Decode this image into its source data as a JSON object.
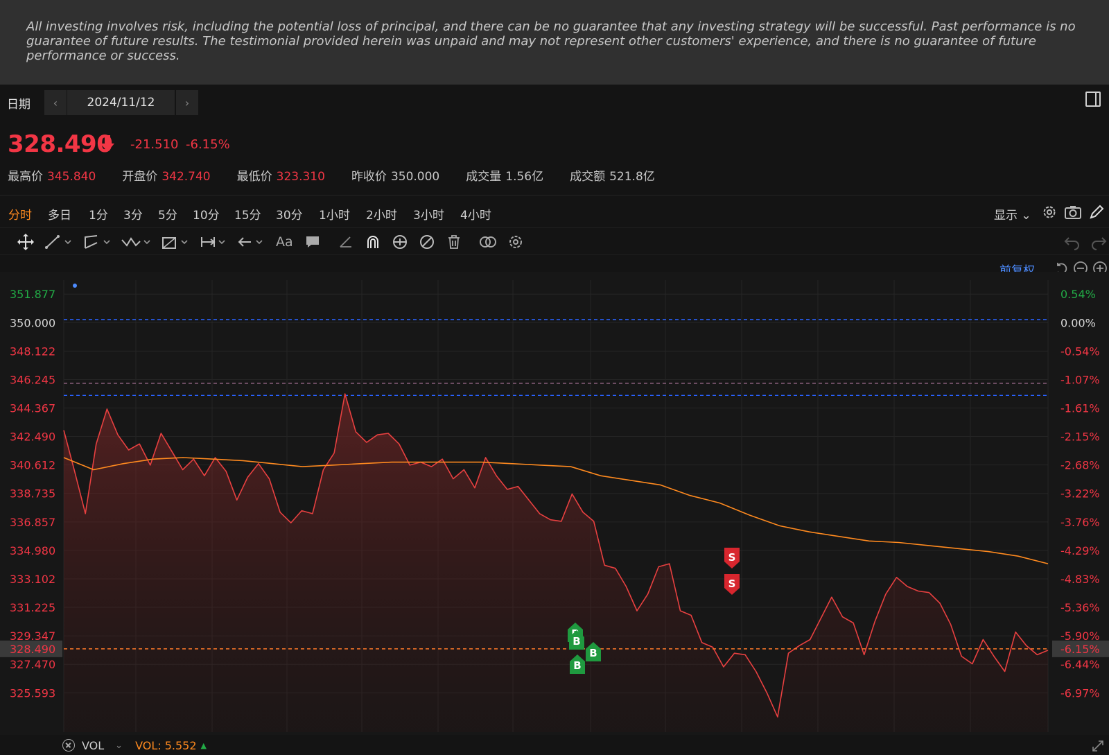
{
  "disclaimer": "All investing involves risk, including the potential loss of principal, and there can be no guarantee that any investing strategy will be successful. Past performance is no guarantee of future results. The testimonial provided herein was unpaid and may not represent other customers' experience, and there is no guarantee of future performance or success.",
  "datebar": {
    "label": "日期",
    "prev": "‹",
    "date": "2024/11/12",
    "next": "›"
  },
  "quote": {
    "price": "328.490",
    "change": "-21.510",
    "change_pct": "-6.15%",
    "stats": [
      {
        "key": "最高价",
        "value": "345.840",
        "color": "red"
      },
      {
        "key": "开盘价",
        "value": "342.740",
        "color": "red"
      },
      {
        "key": "最低价",
        "value": "323.310",
        "color": "red"
      },
      {
        "key": "昨收价",
        "value": "350.000",
        "color": "gray"
      },
      {
        "key": "成交量",
        "value": "1.56亿",
        "color": "gray"
      },
      {
        "key": "成交额",
        "value": "521.8亿",
        "color": "gray"
      }
    ]
  },
  "periods": [
    "分时",
    "多日",
    "1分",
    "3分",
    "5分",
    "10分",
    "15分",
    "30分",
    "1小时",
    "2小时",
    "3小时",
    "4小时"
  ],
  "active_period": "分时",
  "display_menu": "显示",
  "adjust_label": "前复权",
  "colors": {
    "up": "#22ab46",
    "down": "#f23645",
    "avg": "#ff8a1f",
    "accent": "#4d8cff"
  },
  "chart_data": {
    "type": "line",
    "y_ticks_left": [
      "351.877",
      "350.000",
      "348.122",
      "346.245",
      "344.367",
      "342.490",
      "340.612",
      "338.735",
      "336.857",
      "334.980",
      "333.102",
      "331.225",
      "329.347",
      "327.470",
      "325.593"
    ],
    "y_ticks_right": [
      "0.54%",
      "0.00%",
      "-0.54%",
      "-1.07%",
      "-1.61%",
      "-2.15%",
      "-2.68%",
      "-3.22%",
      "-3.76%",
      "-4.29%",
      "-4.83%",
      "-5.36%",
      "-5.90%",
      "-6.44%",
      "-6.97%"
    ],
    "ylim": [
      323.0,
      352.8
    ],
    "previous_close": 350.0,
    "current_price": 328.49,
    "current_pct": "-6.15%",
    "current_label": "328.490",
    "reference_lines": [
      {
        "value": 350.2,
        "color": "#2962ff",
        "style": "dashed"
      },
      {
        "value": 346.0,
        "color": "#9c6b8c",
        "style": "dashed"
      },
      {
        "value": 345.2,
        "color": "#2962ff",
        "style": "dashed"
      }
    ],
    "series": [
      {
        "values": [
          342.9,
          340.2,
          337.4,
          342.0,
          344.3,
          342.6,
          341.6,
          342.0,
          340.6,
          342.7,
          341.5,
          340.3,
          341.0,
          339.9,
          341.1,
          340.2,
          338.3,
          339.8,
          340.7,
          339.7,
          337.5,
          336.8,
          337.6,
          337.4,
          340.3,
          341.4,
          345.3,
          342.8,
          342.1,
          342.6,
          342.7,
          342.0,
          340.6,
          340.8,
          340.5,
          341.0,
          339.7,
          340.3,
          339.1,
          341.1,
          339.9,
          339.0,
          339.2,
          338.3,
          337.4,
          337.0,
          336.9,
          338.7,
          337.5,
          336.9,
          334.0,
          333.8,
          332.6,
          331.0,
          332.1,
          333.9,
          334.1,
          331.0,
          330.7,
          328.9,
          328.6,
          327.3,
          328.2,
          328.1,
          327.0,
          325.6,
          324.0,
          328.2,
          328.7,
          329.1,
          330.5,
          331.9,
          330.6,
          330.2,
          328.1,
          330.3,
          332.1,
          333.2,
          332.6,
          332.3,
          332.2,
          331.5,
          330.1,
          328.0,
          327.5,
          329.1,
          328.0,
          327.0,
          329.6,
          328.7,
          328.1,
          328.4
        ],
        "style": "red line, filled area"
      },
      {
        "values": [
          341.1,
          340.3,
          340.7,
          341.0,
          341.1,
          341.0,
          340.9,
          340.7,
          340.5,
          340.6,
          340.7,
          340.8,
          340.8,
          340.8,
          340.8,
          340.7,
          340.6,
          340.5,
          339.9,
          339.6,
          339.3,
          338.6,
          338.1,
          337.3,
          336.6,
          336.2,
          335.9,
          335.6,
          335.5,
          335.3,
          335.1,
          334.9,
          334.6,
          334.1
        ],
        "style": "orange line"
      }
    ],
    "trade_markers": [
      {
        "label": "B",
        "side": "buy"
      },
      {
        "label": "B",
        "side": "buy"
      },
      {
        "label": "B",
        "side": "buy"
      },
      {
        "label": "B",
        "side": "buy"
      },
      {
        "label": "S",
        "side": "sell"
      },
      {
        "label": "S",
        "side": "sell"
      }
    ],
    "grid": true
  },
  "volume": {
    "name": "VOL",
    "value": "VOL: 5.552",
    "up_glyph": "▲"
  }
}
